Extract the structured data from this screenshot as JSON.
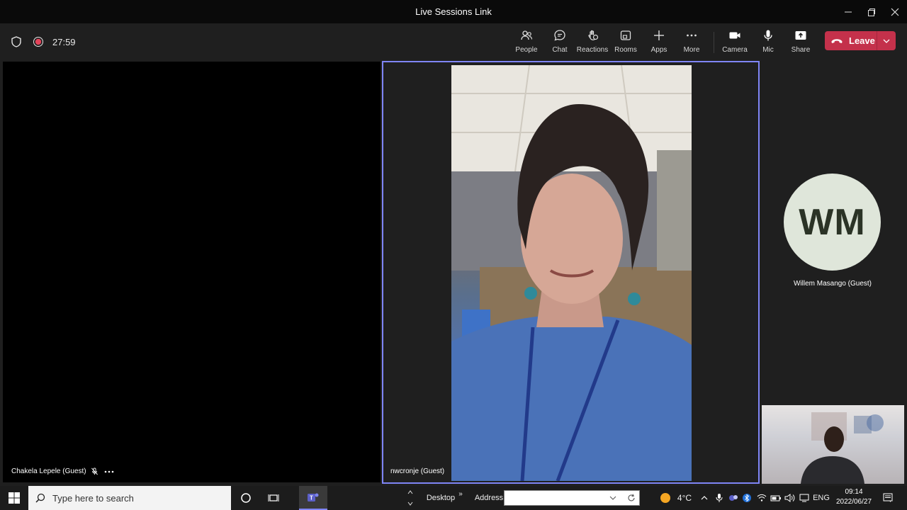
{
  "window": {
    "title": "Live Sessions Link"
  },
  "meeting": {
    "timer": "27:59",
    "toolbar": {
      "people": "People",
      "chat": "Chat",
      "reactions": "Reactions",
      "rooms": "Rooms",
      "apps": "Apps",
      "more": "More",
      "camera": "Camera",
      "mic": "Mic",
      "share": "Share",
      "leave": "Leave"
    },
    "participants": {
      "left": "Chakela Lepele (Guest)",
      "center": "nwcronje (Guest)",
      "right_name": "Willem Masango (Guest)",
      "right_initials": "WM"
    },
    "colors": {
      "leave": "#c4314b",
      "active_border": "#7f85f5"
    }
  },
  "taskbar": {
    "search_placeholder": "Type here to search",
    "desktop": "Desktop",
    "address": "Address",
    "temperature": "4°C",
    "language": "ENG",
    "time": "09:14",
    "date": "2022/06/27"
  }
}
